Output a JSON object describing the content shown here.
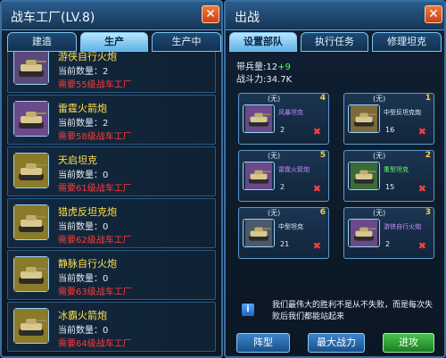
{
  "left": {
    "title": "战车工厂(LV.8)",
    "tabs": [
      {
        "label": "建造",
        "active": false
      },
      {
        "label": "生产",
        "active": true
      },
      {
        "label": "生产中",
        "active": false
      }
    ],
    "units": [
      {
        "name": "游侠自行火炮",
        "count": "当前数量：2",
        "requirement": "需要55级战车工厂",
        "thumb_color": "#5a4a7a"
      },
      {
        "name": "雷霆火箭炮",
        "count": "当前数量：2",
        "requirement": "需要58级战车工厂",
        "thumb_color": "#6a4a8a"
      },
      {
        "name": "天启坦克",
        "count": "当前数量：0",
        "requirement": "需要61级战车工厂",
        "thumb_color": "#8a7a2a"
      },
      {
        "name": "猎虎反坦克炮",
        "count": "当前数量：0",
        "requirement": "需要62级战车工厂",
        "thumb_color": "#8a7a2a"
      },
      {
        "name": "静脉自行火炮",
        "count": "当前数量：0",
        "requirement": "需要63级战车工厂",
        "thumb_color": "#8a7a2a"
      },
      {
        "name": "冰霸火箭炮",
        "count": "当前数量：0",
        "requirement": "需要64级战车工厂",
        "thumb_color": "#8a7a2a"
      }
    ]
  },
  "right": {
    "title": "出战",
    "tabs": [
      {
        "label": "设置部队",
        "active": true
      },
      {
        "label": "执行任务",
        "active": false
      },
      {
        "label": "修理坦克",
        "active": false
      }
    ],
    "troops_label": "带兵量:",
    "troops_value": "12",
    "troops_bonus": "+9",
    "power": "战斗力:34.7K",
    "slots": [
      {
        "none": "(无)",
        "num": "4",
        "name": "风暴坦克",
        "name_color": "#c58cff",
        "count": "2",
        "thumb_color": "#6a4a8a"
      },
      {
        "none": "(无)",
        "num": "1",
        "name": "中型反坦克炮",
        "name_color": "#e8f0f8",
        "count": "16",
        "thumb_color": "#7a6a3a"
      },
      {
        "none": "(无)",
        "num": "5",
        "name": "雷霆火箭炮",
        "name_color": "#c58cff",
        "count": "2",
        "thumb_color": "#6a4a8a"
      },
      {
        "none": "(无)",
        "num": "2",
        "name": "重型坦克",
        "name_color": "#6cff6c",
        "count": "15",
        "thumb_color": "#3a6a3a"
      },
      {
        "none": "(无)",
        "num": "6",
        "name": "中型坦克",
        "name_color": "#e8f0f8",
        "count": "21",
        "thumb_color": "#4a5a6a"
      },
      {
        "none": "(无)",
        "num": "3",
        "name": "游侠自行火炮",
        "name_color": "#c58cff",
        "count": "2",
        "thumb_color": "#6a4a8a"
      }
    ],
    "tip": "我们最伟大的胜利不是从不失败，而是每次失败后我们都能站起来",
    "buttons": {
      "formation": "阵型",
      "max_power": "最大战力",
      "attack": "进攻"
    }
  }
}
